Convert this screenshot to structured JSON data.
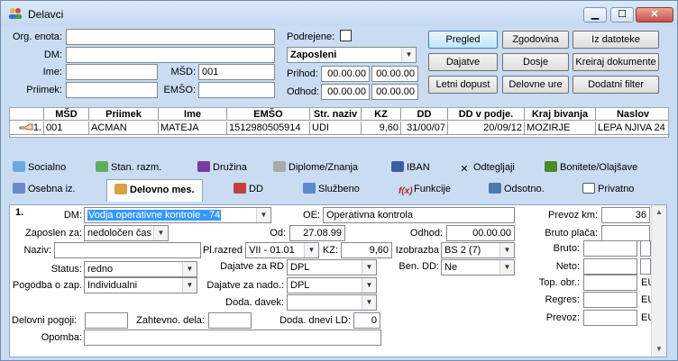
{
  "window": {
    "title": "Delavci"
  },
  "header": {
    "org_enota_label": "Org. enota:",
    "org_enota_value": "",
    "dm_label": "DM:",
    "dm_value": "",
    "ime_label": "Ime:",
    "ime_value": "",
    "msd_label": "MŠD:",
    "msd_value": "001",
    "priimek_label": "Priimek:",
    "priimek_value": "",
    "emso_label": "EMŠO:",
    "emso_value": "",
    "podrejene_label": "Podrejene:",
    "zaposleni_value": "Zaposleni",
    "prihod_label": "Prihod:",
    "prihod_from": "00.00.00",
    "prihod_to": "00.00.00",
    "odhod_label": "Odhod:",
    "odhod_from": "00.00.00",
    "odhod_to": "00.00.00"
  },
  "buttons": {
    "pregled": "Pregled",
    "zgodovina": "Zgodovina",
    "iz_datoteke": "Iz datoteke",
    "dajatve": "Dajatve",
    "dosje": "Dosje",
    "kreiraj": "Kreiraj dokumente",
    "letni": "Letni dopust",
    "delovne_ure": "Delovne ure",
    "dodatni": "Dodatni filter"
  },
  "grid": {
    "columns": [
      "MŠD",
      "Priimek",
      "Ime",
      "EMŠO",
      "Str. naziv",
      "KZ",
      "DD",
      "DD v podje.",
      "Kraj bivanja",
      "Naslov"
    ],
    "row_num": "1.",
    "row": [
      "001",
      "ACMAN",
      "MATEJA",
      "1512980505914",
      "UDI",
      "9,60",
      "31/00/07",
      "20/09/12",
      "MOZIRJE",
      "LEPA NJIVA 24"
    ]
  },
  "tabs_row1": [
    "Socialno",
    "Stan. razm.",
    "Družina",
    "Diplome/Znanja",
    "IBAN",
    "Odtegljaji",
    "Bonitete/Olajšave"
  ],
  "tabs_row2": [
    "Osebna iz.",
    "Delovno mes.",
    "DD",
    "Službeno",
    "Funkcije",
    "Odsotno.",
    "Privatno"
  ],
  "detail": {
    "record_num": "1.",
    "dm_label": "DM:",
    "dm_value": "Vodja operativne kontrole - 74",
    "oe_label": "OE:",
    "oe_value": "Operativna kontrola",
    "prevoz_km_label": "Prevoz km:",
    "prevoz_km_value": "36",
    "zaposlen_label": "Zaposlen za:",
    "zaposlen_value": "nedoločen čas",
    "od_label": "Od:",
    "od_value": "27.08.99",
    "odhod_label": "Odhod:",
    "odhod_value": "00.00.00",
    "bruto_placa_label": "Bruto plača:",
    "naziv_label": "Naziv:",
    "naziv_value": "",
    "plrazred_label": "Pl.razred",
    "plrazred_value": "VII - 01.01",
    "kz_label": "KZ:",
    "kz_value": "9,60",
    "izobrazba_label": "Izobrazba",
    "izobrazba_value": "BS 2 (7)",
    "bruto_label": "Bruto:",
    "status_label": "Status:",
    "status_value": "redno",
    "dajatve_rd_label": "Dajatve za RD",
    "dajatve_rd_value": "DPL",
    "ben_dd_label": "Ben. DD:",
    "ben_dd_value": "Ne",
    "neto_label": "Neto:",
    "pogodba_label": "Pogodba o zap.",
    "pogodba_value": "Individualni",
    "dajatve_nado_label": "Dajatve za nado.:",
    "dajatve_nado_value": "DPL",
    "top_obr_label": "Top. obr.:",
    "top_obr_suffix": "EU",
    "doda_davek_label": "Doda. davek:",
    "regres_label": "Regres:",
    "regres_suffix": "EU",
    "delovni_pogoji_label": "Delovni pogoji:",
    "zahtevno_label": "Zahtevno. dela:",
    "doda_dnevi_label": "Doda. dnevi LD:",
    "doda_dnevi_value": "0",
    "prevoz_label": "Prevoz:",
    "prevoz_suffix": "EU",
    "opomba_label": "Opomba:"
  }
}
